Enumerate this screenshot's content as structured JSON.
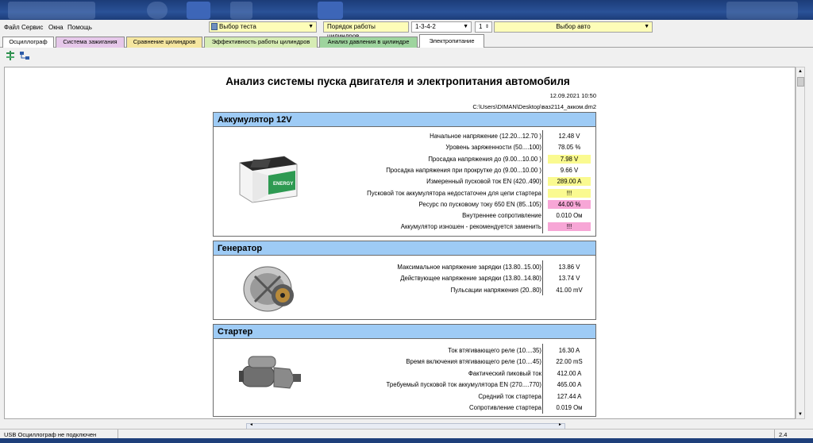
{
  "menu": [
    "Файл",
    "Сервис",
    "Окна",
    "Помощь"
  ],
  "toolbar_combos": {
    "test": "Выбор теста",
    "order_label": "Порядок работы цилиндров",
    "order_value": "1-3-4-2",
    "num": "1",
    "car": "Выбор авто"
  },
  "tabs": [
    {
      "label": "Осциллограф",
      "color": "#ffffff"
    },
    {
      "label": "Система зажигания",
      "color": "#e6c8ea"
    },
    {
      "label": "Сравнение цилиндров",
      "color": "#f5e6a0"
    },
    {
      "label": "Эффективность работы цилиндров",
      "color": "#d6ecb4"
    },
    {
      "label": "Анализ давления в цилиндре",
      "color": "#9ed49e"
    },
    {
      "label": "Электропитание",
      "color": "#ffffff"
    }
  ],
  "report": {
    "title": "Анализ системы пуска двигателя и электропитания автомобиля",
    "date": "12.09.2021 10:50",
    "path": "C:\\Users\\DIMAN\\Desktop\\ваз2114_акком.dm2"
  },
  "battery": {
    "header": "Аккумулятор 12V",
    "rows": [
      {
        "label": "Начальное напряжение (12.20...12.70 )",
        "value": "12.48 V",
        "hl": ""
      },
      {
        "label": "Уровень заряженности (50....100)",
        "value": "78.05 %",
        "hl": ""
      },
      {
        "label": "Просадка напряжения до (9.00...10.00 )",
        "value": "7.98 V",
        "hl": "y"
      },
      {
        "label": "Просадка напряжения при прокрутке до (9.00...10.00 )",
        "value": "9.66 V",
        "hl": ""
      },
      {
        "label": "Измеренный пусковой ток EN (420..490)",
        "value": "289.00 A",
        "hl": "y"
      },
      {
        "label": "Пусковой ток аккумулятора недостаточен для цепи стартера",
        "value": "!!!",
        "hl": "y"
      },
      {
        "label": "Ресурс по пусковому току 650 EN (85..105)",
        "value": "44.00 %",
        "hl": "p"
      },
      {
        "label": "Внутреннее сопротивление",
        "value": "0.010 Ом",
        "hl": ""
      },
      {
        "label": "Аккумулятор изношен - рекомендуется заменить",
        "value": "!!!",
        "hl": "p"
      }
    ]
  },
  "generator": {
    "header": "Генератор",
    "rows": [
      {
        "label": "Максимальное напряжение зарядки (13.80..15.00)",
        "value": "13.86 V",
        "hl": ""
      },
      {
        "label": "Действующее напряжение зарядки (13.80..14.80)",
        "value": "13.74 V",
        "hl": ""
      },
      {
        "label": "Пульсации напряжения (20..80)",
        "value": "41.00 mV",
        "hl": ""
      }
    ]
  },
  "starter": {
    "header": "Стартер",
    "rows": [
      {
        "label": "Ток втягивающего реле (10....35)",
        "value": "16.30 A",
        "hl": ""
      },
      {
        "label": "Время включения втягивающего реле (10....45)",
        "value": "22.00 mS",
        "hl": ""
      },
      {
        "label": "Фактический пиковый ток",
        "value": "412.00 A",
        "hl": ""
      },
      {
        "label": "Требуемый пусковой ток аккумулятора EN (270....770)",
        "value": "465.00 A",
        "hl": ""
      },
      {
        "label": "Средний ток стартера",
        "value": "127.44 A",
        "hl": ""
      },
      {
        "label": "Сопротивление стартера",
        "value": "0.019 Ом",
        "hl": ""
      }
    ]
  },
  "status": {
    "text": "USB Осциллограф не подключен",
    "version": "2.4"
  }
}
